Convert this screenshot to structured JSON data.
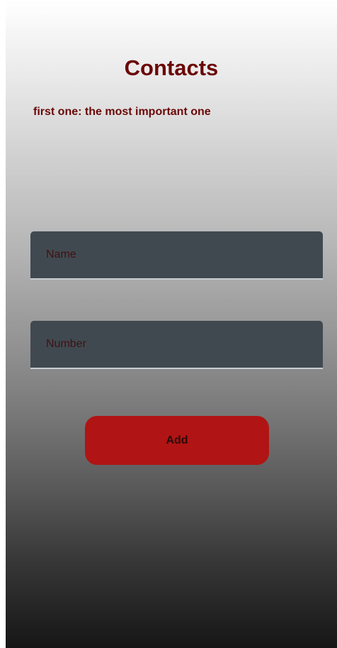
{
  "header": {
    "title": "Contacts",
    "subtitle": "first one: the most important one"
  },
  "form": {
    "name_field": {
      "placeholder": "Name",
      "value": ""
    },
    "number_field": {
      "placeholder": "Number",
      "value": ""
    },
    "add_label": "Add"
  },
  "colors": {
    "title": "#6b0707",
    "field_background": "#414950",
    "button_background": "#b11414"
  }
}
